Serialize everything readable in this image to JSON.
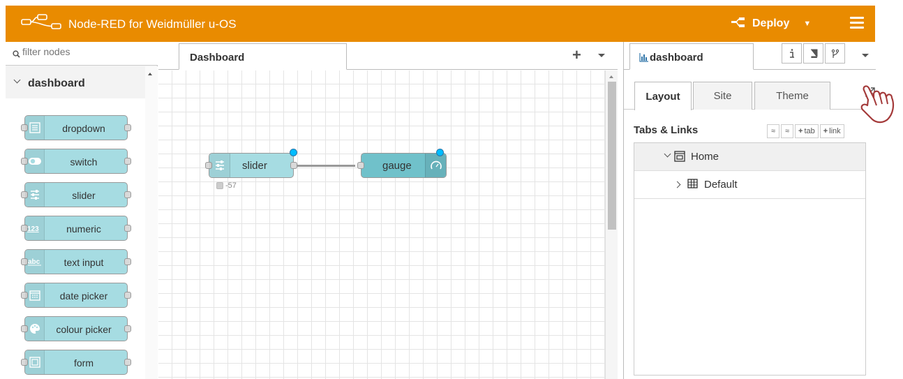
{
  "header": {
    "app_title": "Node-RED for Weidmüller u-OS",
    "deploy_label": "Deploy",
    "accent_color": "#e98b00",
    "logo_icon": "node-red-logo-icon",
    "menu_icon": "hamburger-menu-icon"
  },
  "palette": {
    "filter_placeholder": "filter nodes",
    "category": "dashboard",
    "nodes": [
      {
        "label": "dropdown",
        "icon": "dropdown-list-icon"
      },
      {
        "label": "switch",
        "icon": "toggle-switch-icon"
      },
      {
        "label": "slider",
        "icon": "slider-icon"
      },
      {
        "label": "numeric",
        "icon": "numeric-123-icon"
      },
      {
        "label": "text input",
        "icon": "text-abc-icon"
      },
      {
        "label": "date picker",
        "icon": "calendar-icon"
      },
      {
        "label": "colour picker",
        "icon": "palette-icon"
      },
      {
        "label": "form",
        "icon": "form-icon"
      }
    ]
  },
  "workspace": {
    "flow_tab": "Dashboard",
    "nodes": {
      "slider": {
        "label": "slider",
        "status": "-57"
      },
      "gauge": {
        "label": "gauge"
      }
    }
  },
  "sidebar": {
    "tab_label": "dashboard",
    "sub_tabs": [
      "Layout",
      "Site",
      "Theme"
    ],
    "active_sub_tab": "Layout",
    "section_title": "Tabs & Links",
    "buttons": {
      "tab": "tab",
      "link": "link"
    },
    "tree": [
      {
        "label": "Home",
        "icon": "tab-frame-icon",
        "expanded": true
      },
      {
        "label": "Default",
        "icon": "group-table-icon",
        "expanded": false
      }
    ]
  }
}
